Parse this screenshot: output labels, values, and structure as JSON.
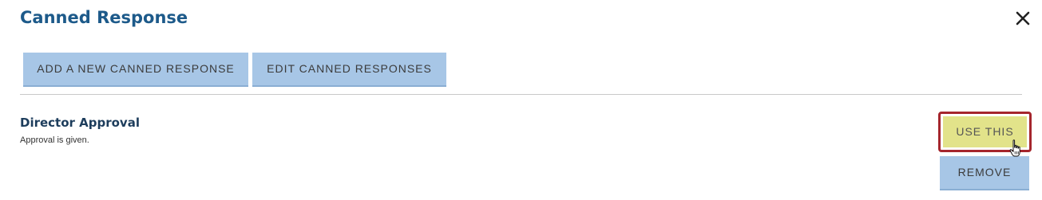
{
  "dialog": {
    "title": "Canned Response",
    "close_icon": "close-icon"
  },
  "toolbar": {
    "add_label": "ADD A NEW CANNED RESPONSE",
    "edit_label": "EDIT CANNED RESPONSES"
  },
  "responses": [
    {
      "name": "Director Approval",
      "text": "Approval is given.",
      "use_label": "USE THIS",
      "remove_label": "REMOVE"
    }
  ],
  "colors": {
    "title": "#1d5a8a",
    "button_blue": "#a7c6e6",
    "use_button": "#e2e38a",
    "highlight_border": "#a5262d"
  },
  "cursor_icon": "hand-pointer-icon"
}
